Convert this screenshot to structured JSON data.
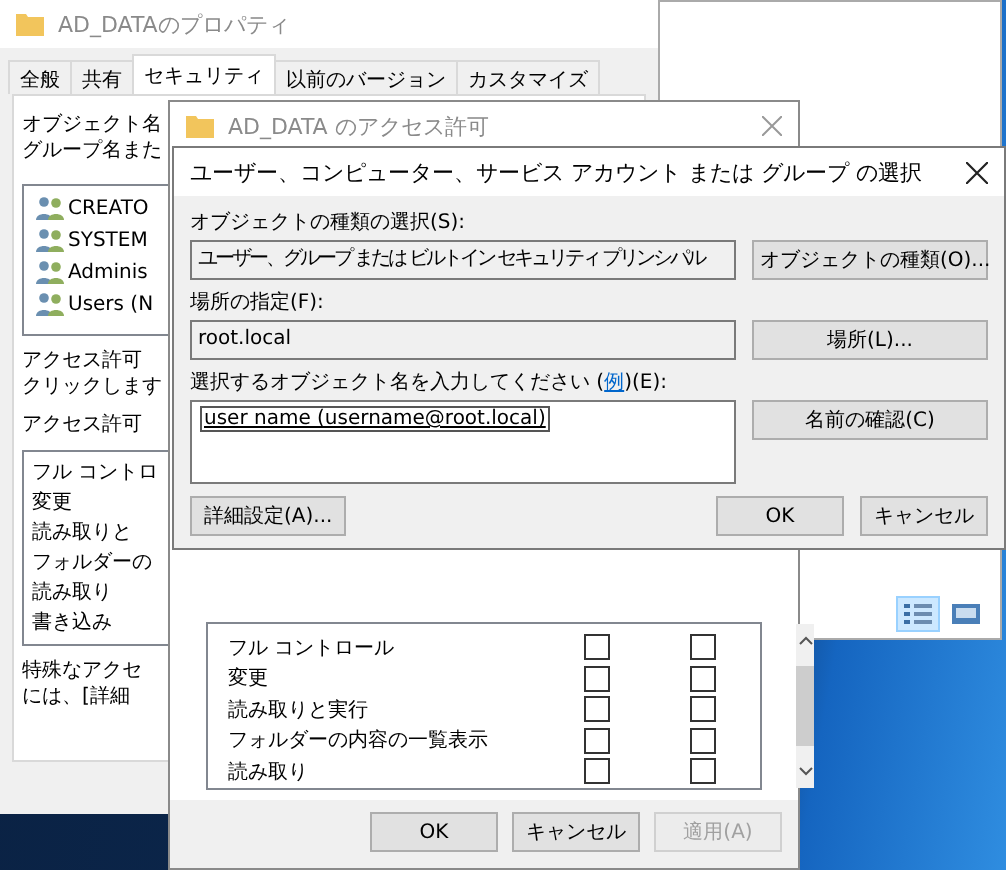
{
  "properties_window": {
    "title": "AD_DATAのプロパティ",
    "tabs": [
      {
        "label": "全般",
        "selected": false
      },
      {
        "label": "共有",
        "selected": false
      },
      {
        "label": "セキュリティ",
        "selected": true
      },
      {
        "label": "以前のバージョン",
        "selected": false
      },
      {
        "label": "カスタマイズ",
        "selected": false
      }
    ],
    "intro": [
      "オブジェクト名",
      "グループ名また"
    ],
    "principals": [
      "CREATO",
      "SYSTEM",
      "Adminis",
      "Users (N"
    ],
    "hint": [
      "アクセス許可",
      "クリックします"
    ],
    "permissions_label": "アクセス許可",
    "permissions": [
      "フル コントロ",
      "変更",
      "読み取りと",
      "フォルダーの",
      "読み取り",
      "書き込み"
    ],
    "footer": [
      "特殊なアクセ",
      "には、[詳細"
    ]
  },
  "explorer_window": {
    "view_buttons": [
      {
        "kind": "details",
        "selected": true
      },
      {
        "kind": "large",
        "selected": false
      }
    ]
  },
  "access_window": {
    "title": "AD_DATA のアクセス許可",
    "permissions": [
      {
        "name": "フル コントロール",
        "allow": false,
        "deny": false
      },
      {
        "name": "変更",
        "allow": false,
        "deny": false
      },
      {
        "name": "読み取りと実行",
        "allow": false,
        "deny": false
      },
      {
        "name": "フォルダーの内容の一覧表示",
        "allow": false,
        "deny": false
      },
      {
        "name": "読み取り",
        "allow": false,
        "deny": false
      }
    ],
    "buttons": [
      {
        "label": "OK",
        "disabled": false
      },
      {
        "label": "キャンセル",
        "disabled": false
      },
      {
        "label": "適用(A)",
        "disabled": true
      }
    ]
  },
  "select_dialog": {
    "title": "ユーザー、コンピューター、サービス アカウント または グループ の選択",
    "object_types_label": "オブジェクトの種類の選択(S):",
    "object_types": "ユーザー、グループ または ビルトイン セキュリティ プリンシパル",
    "object_types_button": "オブジェクトの種類(O)...",
    "location_label": "場所の指定(F):",
    "location": "root.local",
    "location_button": "場所(L)...",
    "names_label_before": "選択するオブジェクト名を入力してください (",
    "names_label_link": "例",
    "names_label_after": ")(E):",
    "names_value": "user name (username@root.local)",
    "check_names_button": "名前の確認(C)",
    "advanced_button": "詳細設定(A)...",
    "ok_button": "OK",
    "cancel_button": "キャンセル"
  }
}
